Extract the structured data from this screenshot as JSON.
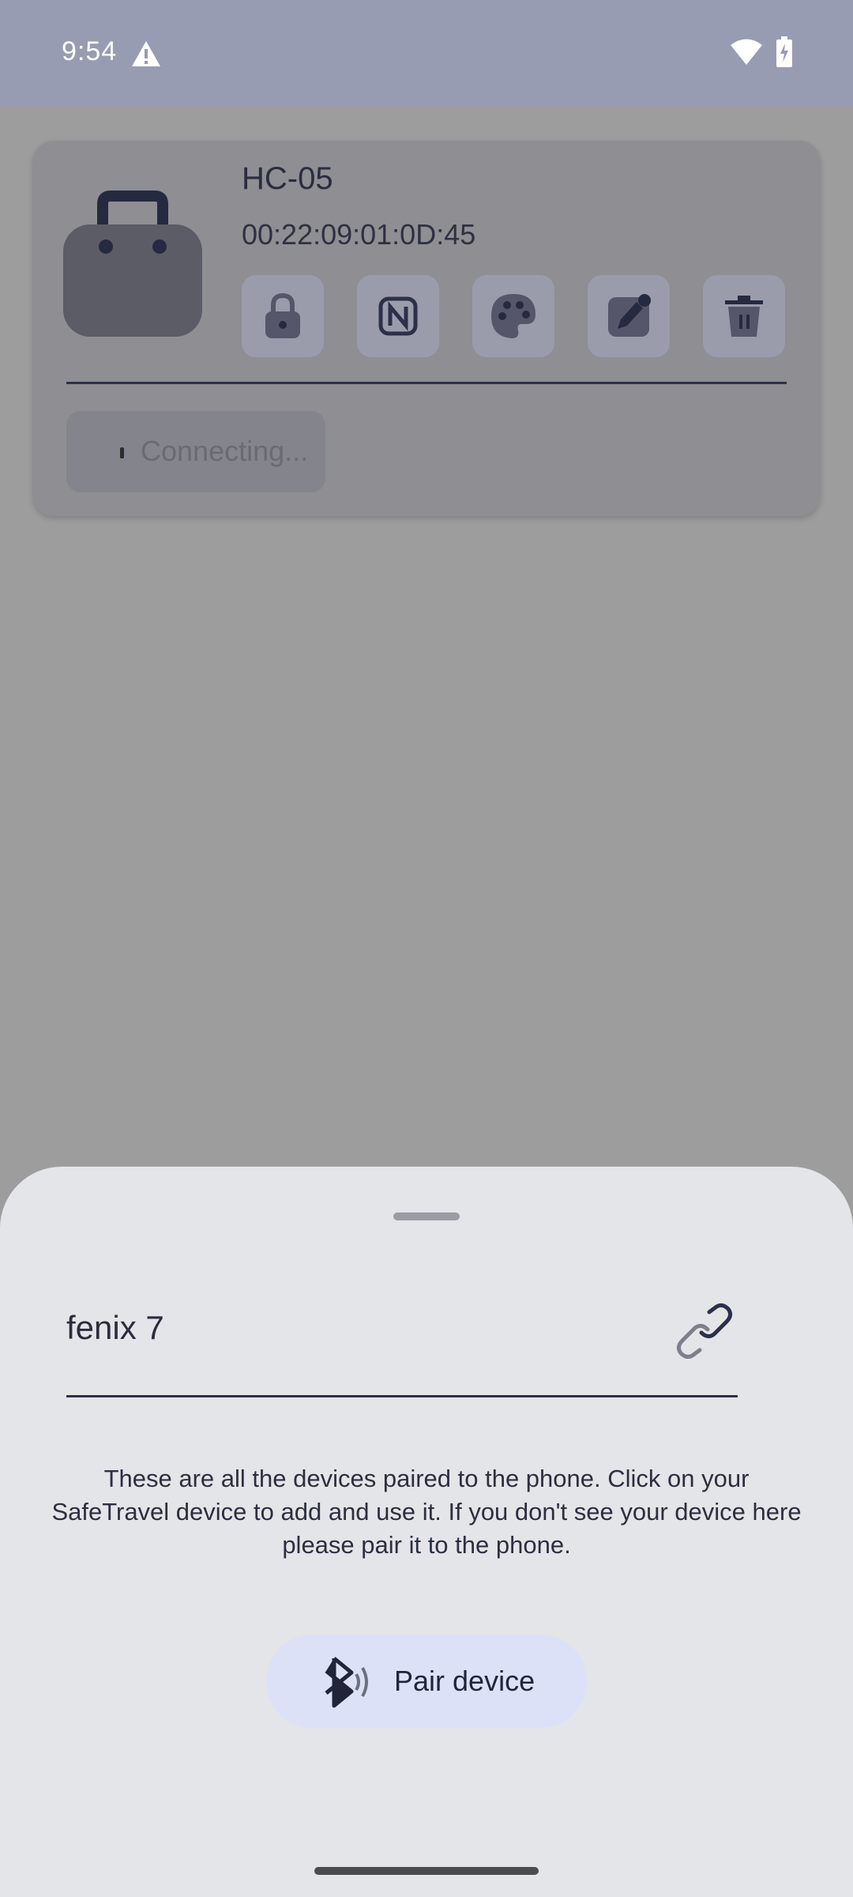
{
  "status_bar": {
    "time": "9:54",
    "icons": [
      "warning-icon",
      "wifi-icon",
      "battery-charging-icon"
    ]
  },
  "device_card": {
    "name": "HC-05",
    "mac": "00:22:09:01:0D:45",
    "actions": [
      "lock-icon",
      "nfc-icon",
      "palette-icon",
      "edit-icon",
      "delete-icon"
    ],
    "status": "Connecting..."
  },
  "bottom_sheet": {
    "paired_devices": [
      {
        "name": "fenix 7",
        "icon": "link-icon"
      }
    ],
    "help_text": "These are all the devices paired to the phone. Click on your SafeTravel device to add and use it. If you don't see your device here please pair it to the phone.",
    "pair_button_label": "Pair device"
  },
  "colors": {
    "scrim": "#9d9d9d",
    "status_bar": "#979cb2",
    "sheet": "#e4e5e8",
    "pair_button": "#dde1f7",
    "primary_dark": "#2c3048"
  }
}
